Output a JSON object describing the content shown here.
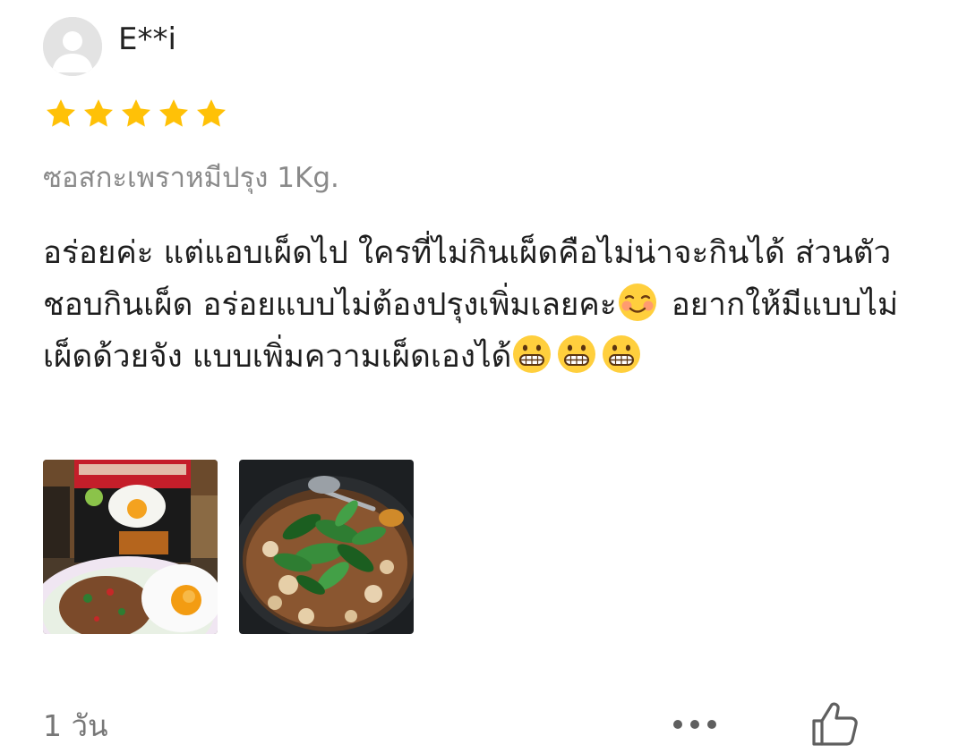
{
  "review": {
    "username": "E**i",
    "rating": 5,
    "rating_max": 5,
    "star_color": "#FFC107",
    "variant": "ซอสกะเพราหมีปรุง 1Kg.",
    "text_parts": {
      "p1": "อร่อยค่ะ แต่แอบเผ็ดไป ใครที่ไม่กินเผ็ดคือไม่น่าจะกินได้ ส่วนตัวชอบกินเผ็ด อร่อยแบบไม่ต้องปรุงเพิ่มเลยคะ",
      "p2": " อยากให้มีแบบไม่เผ็ดด้วยจัง แบบเพิ่มความเผ็ดเองได้"
    },
    "emojis": [
      "smiling-face-with-blush",
      "grinning-face-with-big-eyes",
      "grinning-face-with-big-eyes",
      "grinning-face-with-big-eyes"
    ],
    "photos": [
      {
        "name": "review-photo-1",
        "depicts": "basil sauce package with fried egg and stir-fried pork on plate"
      },
      {
        "name": "review-photo-2",
        "depicts": "stir-fried minced pork with holy basil in wok"
      }
    ],
    "time_ago": "1 วัน",
    "icons": {
      "more": "more-horizontal-icon",
      "like": "thumbs-up-icon"
    }
  }
}
